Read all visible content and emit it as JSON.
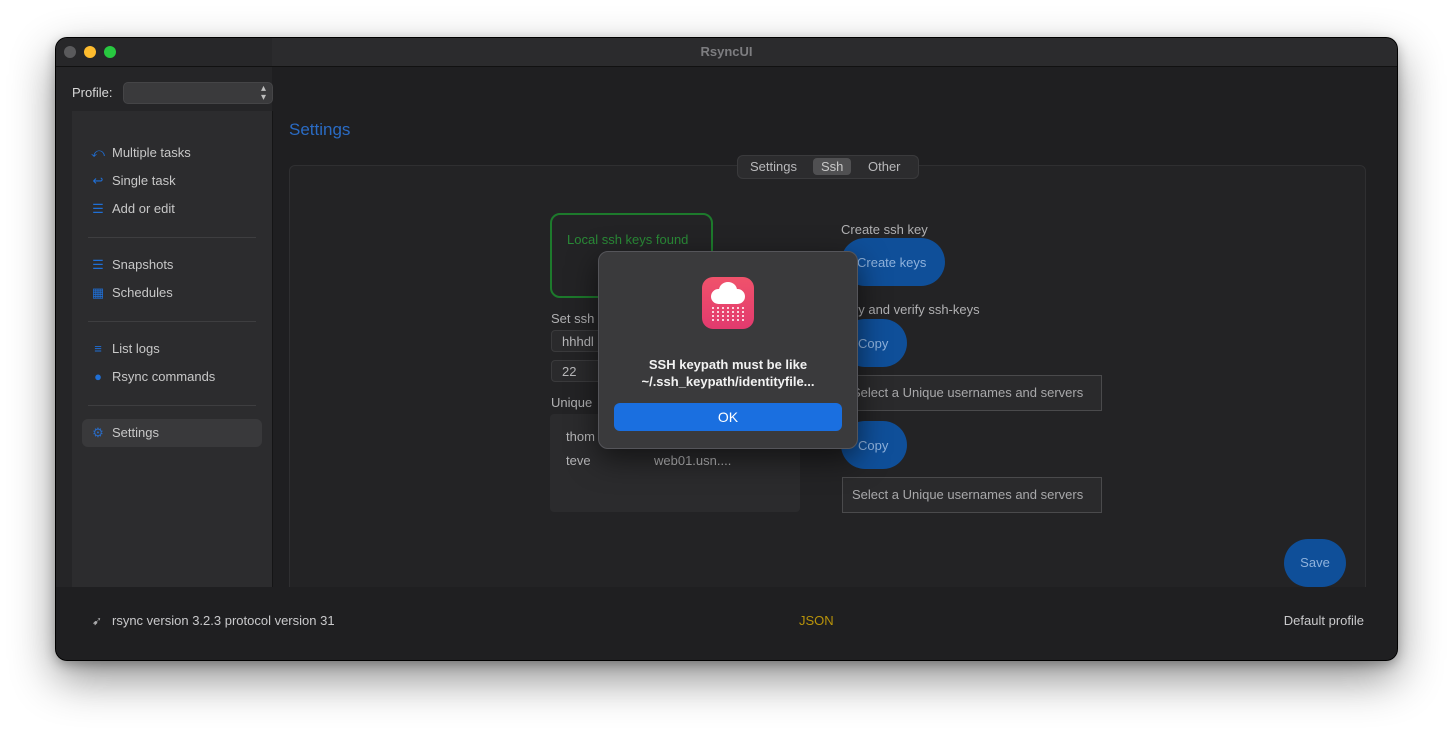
{
  "window": {
    "title": "RsyncUI"
  },
  "profile": {
    "label": "Profile:",
    "value": ""
  },
  "sidebar": {
    "items": [
      {
        "label": "Multiple tasks",
        "icon": "arrowshape-turn-up-left-2-icon"
      },
      {
        "label": "Single task",
        "icon": "arrowshape-turn-up-left-icon"
      },
      {
        "label": "Add or edit",
        "icon": "list-icon"
      },
      {
        "label": "Snapshots",
        "icon": "list-icon"
      },
      {
        "label": "Schedules",
        "icon": "calendar-icon"
      },
      {
        "label": "List logs",
        "icon": "text-lines-icon"
      },
      {
        "label": "Rsync commands",
        "icon": "circle-icon"
      },
      {
        "label": "Settings",
        "icon": "gear-icon"
      }
    ]
  },
  "main": {
    "title": "Settings",
    "tabs": [
      "Settings",
      "Ssh",
      "Other"
    ],
    "selected_tab": "Ssh",
    "keys_status": "Local ssh keys found",
    "set_ssh_label": "Set ssh",
    "keypath_value": "hhhdl",
    "port_value": "22",
    "unique_label": "Unique",
    "users": [
      {
        "user": "thom",
        "server": ""
      },
      {
        "user": "teve",
        "server": "web01.usn...."
      }
    ],
    "create_ssh_key_label": "Create ssh key",
    "create_keys_button": "Create keys",
    "copy_verify_label": "py and verify ssh-keys",
    "copy_button_1": "Copy",
    "select_unique_1": "Select a Unique usernames and servers",
    "copy_button_2": "Copy",
    "select_unique_2": "Select a Unique usernames and servers",
    "save_button": "Save"
  },
  "statusbar": {
    "rsync_version": "rsync  version 3.2.3  protocol version 31",
    "format": "JSON",
    "profile": "Default profile"
  },
  "alert": {
    "message_line1": "SSH keypath must be like",
    "message_line2": "~/.ssh_keypath/identityfile...",
    "ok_button": "OK"
  },
  "colors": {
    "accent": "#1a6fe0",
    "success": "#1d7a2c",
    "json_label": "#b8930a"
  }
}
